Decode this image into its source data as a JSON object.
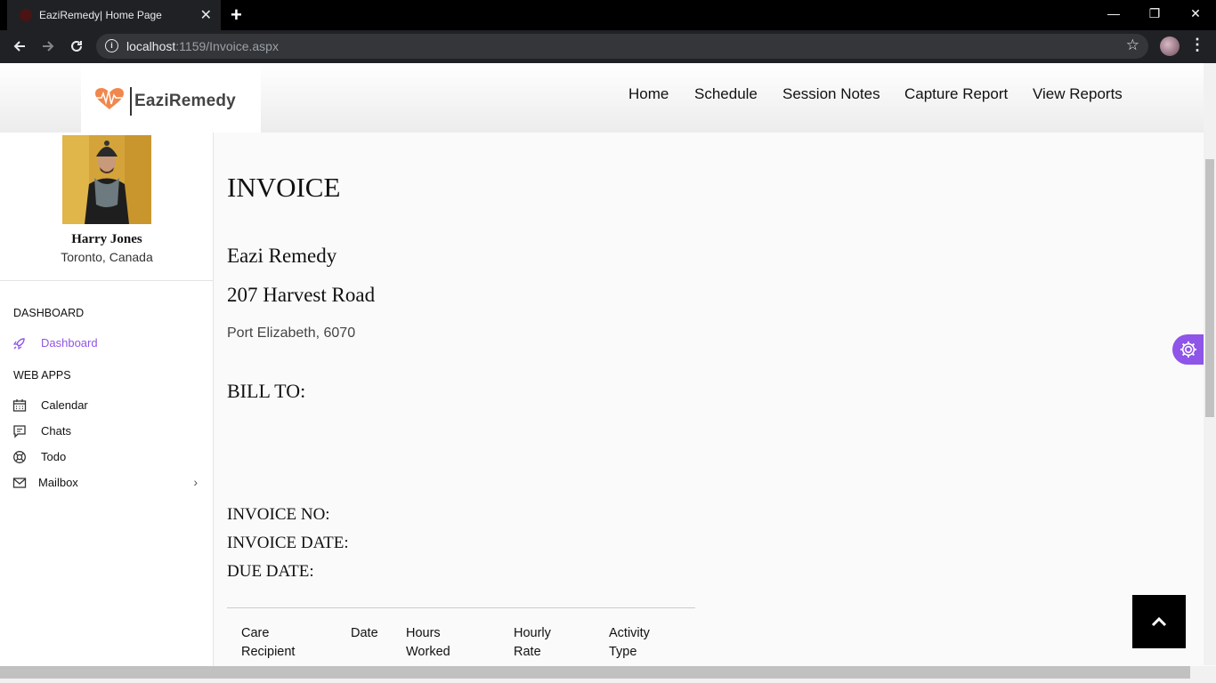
{
  "browser": {
    "tab_title": "EaziRemedy| Home Page",
    "tab_close": "✕",
    "new_tab": "+",
    "url_host": "localhost",
    "url_path": ":1159/Invoice.aspx",
    "window_controls": [
      "—",
      "❐",
      "✕"
    ]
  },
  "site": {
    "logo_text": "EaziRemedy",
    "brand_color": "#f07a3a",
    "accent_color": "#8e55e8",
    "nav": [
      "Home",
      "Schedule",
      "Session Notes",
      "Capture Report",
      "View Reports"
    ]
  },
  "sidebar": {
    "user_name": "Harry Jones",
    "user_location": "Toronto, Canada",
    "dashboard_heading": "DASHBOARD",
    "dashboard_item": "Dashboard",
    "webapps_heading": "WEB APPS",
    "items": [
      {
        "label": "Calendar",
        "icon": "calendar-icon"
      },
      {
        "label": "Chats",
        "icon": "chat-icon"
      },
      {
        "label": "Todo",
        "icon": "lifebuoy-icon"
      },
      {
        "label": "Mailbox",
        "icon": "mail-icon"
      }
    ]
  },
  "invoice": {
    "title": "INVOICE",
    "company": "Eazi Remedy",
    "street": "207 Harvest Road",
    "city": "Port Elizabeth, 6070",
    "bill_to": "BILL TO:",
    "invoice_no_label": "INVOICE NO:",
    "invoice_date_label": "INVOICE DATE:",
    "due_date_label": "DUE DATE:",
    "columns": [
      [
        "Care",
        "Recipient"
      ],
      [
        "Date",
        ""
      ],
      [
        "Hours",
        "Worked"
      ],
      [
        "Hourly",
        "Rate"
      ],
      [
        "Activity",
        "Type"
      ]
    ]
  }
}
